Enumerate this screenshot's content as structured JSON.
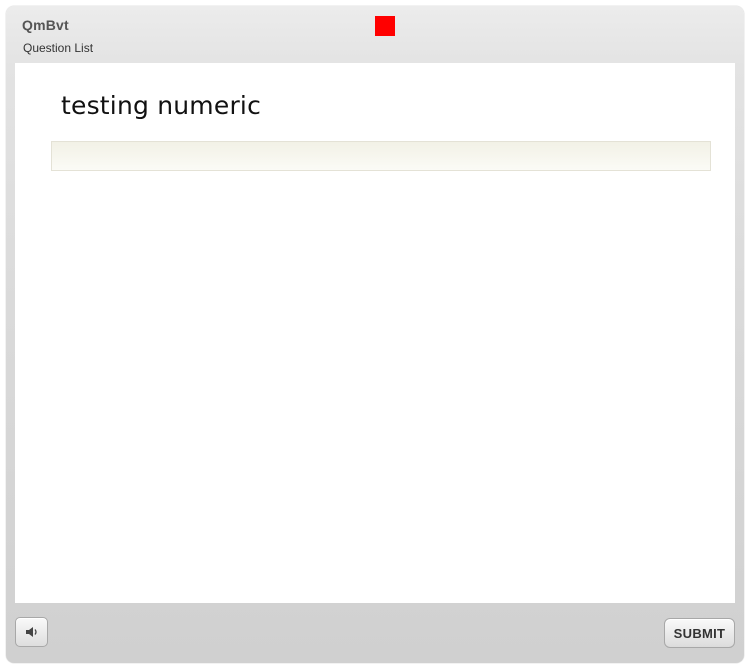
{
  "header": {
    "title": "QmBvt",
    "subtitle": "Question List",
    "status_color": "#ff0000"
  },
  "question": {
    "text": "testing numeric",
    "answer_value": "",
    "answer_placeholder": ""
  },
  "footer": {
    "audio_icon": "speaker-icon",
    "submit_label": "SUBMIT"
  }
}
